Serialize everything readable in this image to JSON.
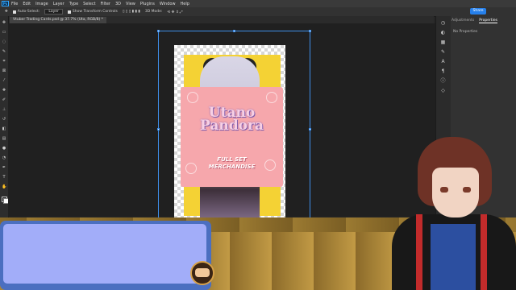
{
  "app": {
    "logo_text": "Ps"
  },
  "menubar": [
    "File",
    "Edit",
    "Image",
    "Layer",
    "Type",
    "Select",
    "Filter",
    "3D",
    "View",
    "Plugins",
    "Window",
    "Help"
  ],
  "options_bar": {
    "auto_select_label": "Auto-Select:",
    "layer_select": "Layer",
    "transform_controls_label": "Show Transform Controls",
    "mode_3d_label": "3D Mode:",
    "share_label": "Share"
  },
  "document": {
    "tab_title": "Vtuber Trading Cards.psd @ 37.7% (Uta, RGB/8) *"
  },
  "right_panel": {
    "tabs": [
      "Adjustments",
      "Properties"
    ],
    "active_tab": "Properties",
    "no_properties": "No Properties"
  },
  "artwork": {
    "card_title_line1": "Utano",
    "card_title_line2": "Pandora",
    "card_subtitle_line1": "FULL SET",
    "card_subtitle_line2": "MERCHANDISE"
  },
  "colors": {
    "selection_blue": "#3e8ee8",
    "dialog_border": "#4b6fc0",
    "dialog_fill": "#a2adf9",
    "card_pink": "#f6a7ac",
    "accent_blue": "#2680eb"
  }
}
